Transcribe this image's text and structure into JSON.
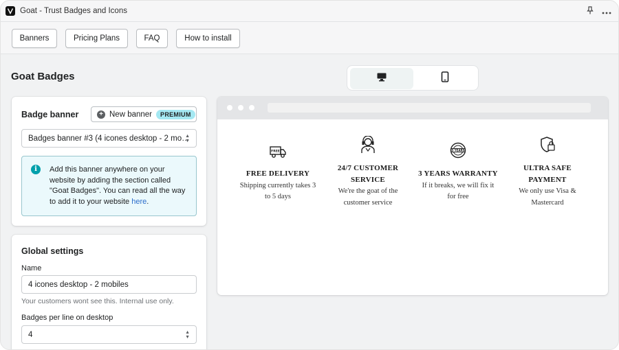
{
  "app": {
    "title": "Goat - Trust Badges and Icons"
  },
  "titlebar": {
    "pin_icon": "pin-icon",
    "more_icon": "more-icon"
  },
  "nav": {
    "buttons": [
      {
        "label": "Banners"
      },
      {
        "label": "Pricing Plans"
      },
      {
        "label": "FAQ"
      },
      {
        "label": "How to install"
      }
    ]
  },
  "page": {
    "title": "Goat Badges"
  },
  "view_toggle": {
    "desktop_icon": "desktop-icon",
    "mobile_icon": "mobile-icon",
    "selected": "desktop"
  },
  "badge_banner": {
    "title": "Badge banner",
    "new_button_label": "New banner",
    "premium_label": "PREMIUM",
    "selected_banner": "Badges banner #3 (4 icones desktop - 2 mo…",
    "info_text": "Add this banner anywhere on your website by adding the section called \"Goat Badges\". You can read all the way to add it to your website ",
    "info_link": "here",
    "info_end": "."
  },
  "global_settings": {
    "title": "Global settings",
    "name_label": "Name",
    "name_value": "4 icones desktop - 2 mobiles",
    "name_help": "Your customers wont see this. Internal use only.",
    "per_line_label": "Badges per line on desktop",
    "per_line_value": "4"
  },
  "preview": {
    "badges": [
      {
        "icon": "delivery-truck-icon",
        "title_1": "FREE DELIVERY",
        "title_2": "",
        "desc_1": "Shipping currently takes 3",
        "desc_2": "to 5 days"
      },
      {
        "icon": "customer-service-icon",
        "title_1": "24/7 CUSTOMER",
        "title_2": "SERVICE",
        "desc_1": "We're the goat of the",
        "desc_2": "customer service"
      },
      {
        "icon": "warranty-seal-icon",
        "title_1": "3 YEARS WARRANTY",
        "title_2": "",
        "desc_1": "If it breaks, we will fix it",
        "desc_2": "for free"
      },
      {
        "icon": "secure-shield-lock-icon",
        "title_1": "ULTRA SAFE",
        "title_2": "PAYMENT",
        "desc_1": "We only use Visa &",
        "desc_2": "Mastercard"
      }
    ],
    "warranty_seal_text": "3 YEARS",
    "delivery_truck_text": "FREE"
  }
}
